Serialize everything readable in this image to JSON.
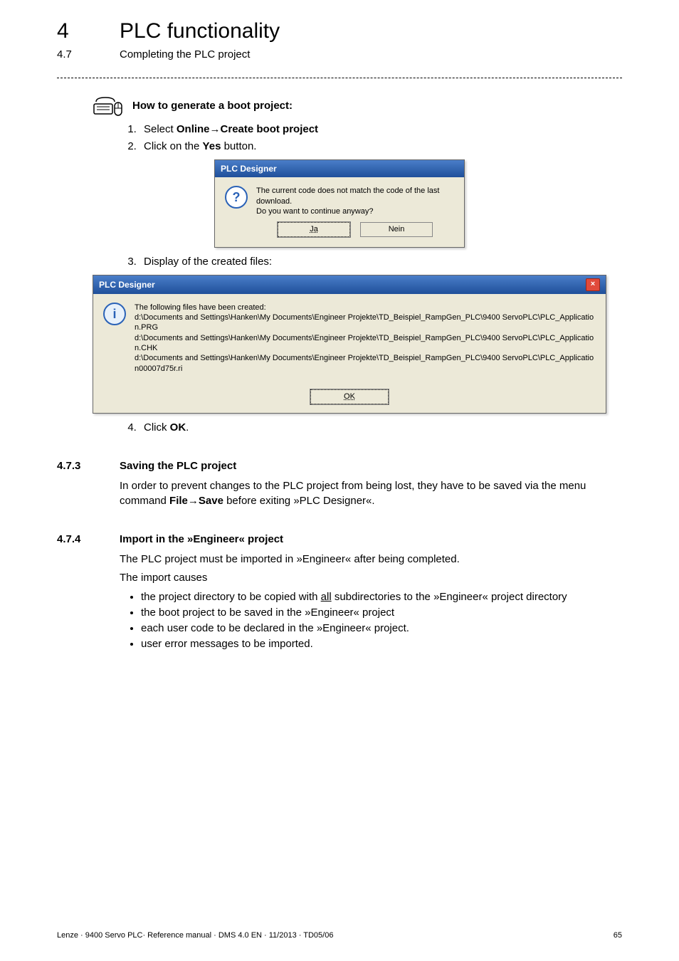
{
  "chapter": {
    "number": "4",
    "title": "PLC functionality"
  },
  "subheader": {
    "number": "4.7",
    "title": "Completing the PLC project"
  },
  "howto": {
    "lead": "How to generate a boot project:"
  },
  "steps_a": [
    {
      "prefix": "Select ",
      "bold1": "Online",
      "arrow": "→",
      "bold2": "Create boot project"
    },
    {
      "prefix": "Click on the ",
      "bold1": "Yes",
      "suffix": " button."
    }
  ],
  "dialog1": {
    "title": "PLC Designer",
    "line1": "The current code does not match the code of the last download.",
    "line2": "Do you want to continue anyway?",
    "btn_yes": "Ja",
    "btn_no": "Nein"
  },
  "steps_b": [
    {
      "text": "Display of the created files:"
    }
  ],
  "dialog2": {
    "title": "PLC Designer",
    "close": "×",
    "intro": "The following files have been created:",
    "paths": [
      "d:\\Documents and Settings\\Hanken\\My Documents\\Engineer Projekte\\TD_Beispiel_RampGen_PLC\\9400 ServoPLC\\PLC_Application.PRG",
      "d:\\Documents and Settings\\Hanken\\My Documents\\Engineer Projekte\\TD_Beispiel_RampGen_PLC\\9400 ServoPLC\\PLC_Application.CHK",
      "d:\\Documents and Settings\\Hanken\\My Documents\\Engineer Projekte\\TD_Beispiel_RampGen_PLC\\9400 ServoPLC\\PLC_Application00007d75r.ri"
    ],
    "btn_ok": "OK"
  },
  "steps_c": [
    {
      "prefix": "Click ",
      "bold1": "OK",
      "suffix": "."
    }
  ],
  "sec473": {
    "num": "4.7.3",
    "title": "Saving the PLC project",
    "p_before": "In order to prevent changes to the PLC project from being lost, they have to be saved via the menu command ",
    "bold1": "File",
    "arrow": "→",
    "bold2": "Save",
    "p_after": " before exiting »PLC Designer«."
  },
  "sec474": {
    "num": "4.7.4",
    "title": "Import in the »Engineer« project",
    "p1": "The PLC project must be imported in »Engineer« after being completed.",
    "p2": "The import causes",
    "b1_pre": "the project directory to be copied with ",
    "b1_u": "all",
    "b1_post": " subdirectories to the »Engineer« project directory",
    "b2": "the boot project to be saved in the »Engineer« project",
    "b3": "each user code to be declared in the »Engineer« project.",
    "b4": "user error messages to be imported."
  },
  "footer": {
    "left": "Lenze · 9400 Servo PLC· Reference manual · DMS 4.0 EN · 11/2013 · TD05/06",
    "right": "65"
  }
}
